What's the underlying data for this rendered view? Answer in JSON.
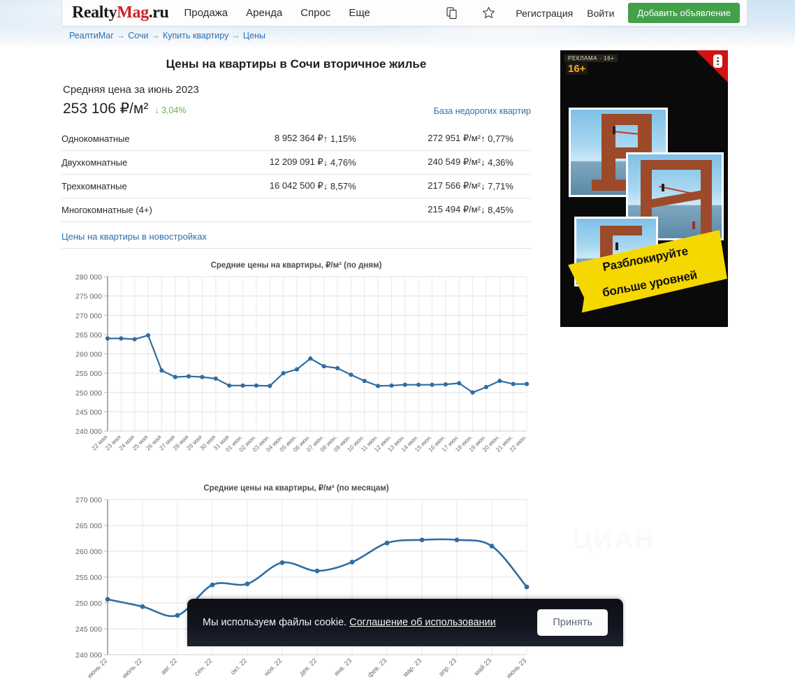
{
  "header": {
    "logo_realty": "Realty",
    "logo_mag": "Mag",
    "logo_ru": ".ru",
    "nav": [
      {
        "label": "Продажа",
        "name": "nav-prodazha"
      },
      {
        "label": "Аренда",
        "name": "nav-arenda"
      },
      {
        "label": "Спрос",
        "name": "nav-spros"
      },
      {
        "label": "Еще",
        "name": "nav-esche"
      }
    ],
    "compare_icon": "copy-icon",
    "favorites_icon": "star-icon",
    "register_label": "Регистрация",
    "login_label": "Войти",
    "add_listing_label": "Добавить объявление",
    "add_listing_color": "#44a04b"
  },
  "breadcrumb": [
    "РеалтиМаг",
    "Сочи",
    "Купить квартиру",
    "Цены"
  ],
  "breadcrumb_separator": "→",
  "main": {
    "page_title": "Цены на квартиры в Сочи вторичное жилье",
    "avg_label": "Средняя цена за июнь 2023",
    "avg_price": "253 106 ₽/м²",
    "avg_delta": "↓ 3,04%",
    "avg_delta_dir": "down",
    "cheap_base_link": "База недорогих квартир",
    "new_buildings_link": "Цены на квартиры в новостройках",
    "rows": [
      {
        "name": "Однокомнатные",
        "price": "8 952 364 ₽",
        "price_delta": "↑ 1,15%",
        "price_delta_dir": "up",
        "sqm": "272 951 ₽/м²",
        "sqm_delta": "↑ 0,77%",
        "sqm_delta_dir": "up"
      },
      {
        "name": "Двухкомнатные",
        "price": "12 209 091 ₽",
        "price_delta": "↓ 4,76%",
        "price_delta_dir": "down",
        "sqm": "240 549 ₽/м²",
        "sqm_delta": "↓ 4,36%",
        "sqm_delta_dir": "down"
      },
      {
        "name": "Трехкомнатные",
        "price": "16 042 500 ₽",
        "price_delta": "↓ 8,57%",
        "price_delta_dir": "down",
        "sqm": "217 566 ₽/м²",
        "sqm_delta": "↓ 7,71%",
        "sqm_delta_dir": "down"
      },
      {
        "name": "Многокомнатные (4+)",
        "price": "",
        "price_delta": "",
        "price_delta_dir": "",
        "sqm": "215 494 ₽/м²",
        "sqm_delta": "↓ 8,45%",
        "sqm_delta_dir": "down"
      }
    ]
  },
  "chart_data": [
    {
      "type": "line",
      "name": "daily",
      "title": "Средние цены на квартиры, ₽/м² (по дням)",
      "xlabel": "",
      "ylabel": "",
      "ylim": [
        240000,
        280000
      ],
      "yticks": [
        240000,
        245000,
        250000,
        255000,
        260000,
        265000,
        270000,
        275000,
        280000
      ],
      "ytick_labels": [
        "240 000",
        "245 000",
        "250 000",
        "255 000",
        "260 000",
        "265 000",
        "270 000",
        "275 000",
        "280 000"
      ],
      "grid": true,
      "legend": "none",
      "line_color": "#2e6da4",
      "categories": [
        "22 мая",
        "23 мая",
        "24 мая",
        "25 мая",
        "26 мая",
        "27 мая",
        "28 мая",
        "29 мая",
        "30 мая",
        "31 мая",
        "01 июн.",
        "02 июн.",
        "03 июн.",
        "04 июн.",
        "05 июн.",
        "06 июн.",
        "07 июн.",
        "08 июн.",
        "09 июн.",
        "10 июн.",
        "11 июн.",
        "12 июн.",
        "13 июн.",
        "14 июн.",
        "15 июн.",
        "16 июн.",
        "17 июн.",
        "18 июн.",
        "19 июн.",
        "20 июн.",
        "21 июн.",
        "22 июн."
      ],
      "values": [
        264000,
        264000,
        263800,
        264800,
        255700,
        254000,
        254200,
        254000,
        253600,
        251800,
        251800,
        251800,
        251700,
        255000,
        256000,
        258800,
        256800,
        256300,
        254600,
        253000,
        251700,
        251800,
        252000,
        252000,
        252000,
        252100,
        252400,
        250000,
        251400,
        253000,
        252200,
        252200
      ]
    },
    {
      "type": "line",
      "name": "monthly",
      "title": "Средние цены на квартиры, ₽/м² (по месяцам)",
      "xlabel": "",
      "ylabel": "",
      "ylim": [
        240000,
        270000
      ],
      "yticks": [
        240000,
        245000,
        250000,
        255000,
        260000,
        265000,
        270000
      ],
      "ytick_labels": [
        "240 000",
        "245 000",
        "250 000",
        "255 000",
        "260 000",
        "265 000",
        "270 000"
      ],
      "grid": true,
      "legend": "none",
      "line_color": "#2e6da4",
      "categories": [
        "июнь 22",
        "июль 22",
        "авг. 22",
        "сен. 22",
        "окт. 22",
        "ноя. 22",
        "дек. 22",
        "янв. 23",
        "фев. 23",
        "мар. 23",
        "апр. 23",
        "май 23",
        "июнь 23"
      ],
      "values": [
        250700,
        249300,
        247600,
        253500,
        253700,
        257800,
        256200,
        257900,
        261600,
        262200,
        262200,
        261000,
        253100
      ]
    }
  ],
  "ad": {
    "label": "РЕКЛАМА · 16+",
    "age": "16+",
    "menu_icon": "kebab-menu-icon",
    "banner_line1": "Разблокируйте",
    "banner_line2": "больше уровней"
  },
  "watermark": "ЦИАН",
  "cookiebar": {
    "text": "Мы используем файлы cookie.",
    "link": "Соглашение об использовании",
    "accept_label": "Принять"
  }
}
